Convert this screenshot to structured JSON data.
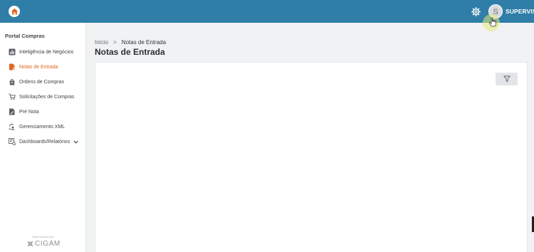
{
  "header": {
    "logo_icon": "house-circle-icon",
    "settings_icon": "gear-icon",
    "avatar_initial": "S",
    "username": "SUPERVISOR",
    "brand_color": "#2f7ea7"
  },
  "sidebar": {
    "title": "Portal Compras",
    "items": [
      {
        "label": "Inteligência de Negócios",
        "icon": "bar-chart-icon",
        "active": false
      },
      {
        "label": "Notas de Entrada",
        "icon": "document-person-icon",
        "active": true
      },
      {
        "label": "Ordens de Compras",
        "icon": "shopping-bag-icon",
        "active": false
      },
      {
        "label": "Solicitações de Compras",
        "icon": "cart-icon",
        "active": false
      },
      {
        "label": "Pré Nota",
        "icon": "document-edit-icon",
        "active": false
      },
      {
        "label": "Gerenciamento XML",
        "icon": "sync-xml-icon",
        "active": false
      },
      {
        "label": "Dashboards/Relatórios",
        "icon": "dashboard-report-icon",
        "active": false,
        "expandable": true
      }
    ],
    "active_color": "#e0641f",
    "powered_by": "Desenvolvido por",
    "brand": "CIGAM"
  },
  "breadcrumb": {
    "home": "Início",
    "separator": ">",
    "current": "Notas de Entrada"
  },
  "page": {
    "title": "Notas de Entrada",
    "filter_icon": "filter-icon"
  }
}
